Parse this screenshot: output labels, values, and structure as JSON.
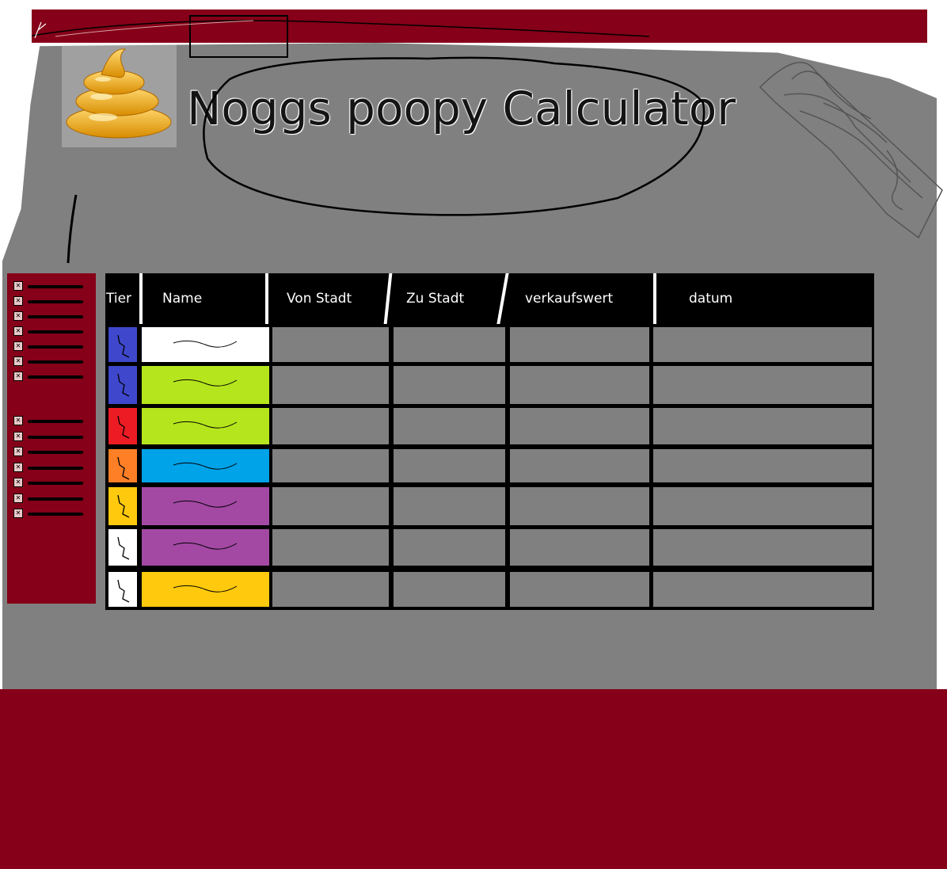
{
  "app": {
    "title": "Noggs poopy Calculator",
    "logo_icon": "poop-icon"
  },
  "colors": {
    "brand": "#850018",
    "background": "#808080",
    "table_border": "#000000"
  },
  "sidebar": {
    "group_1_count": 7,
    "group_2_count": 7,
    "item_icon": "checkbox-icon"
  },
  "table": {
    "columns": [
      {
        "label": "Tier"
      },
      {
        "label": "Name"
      },
      {
        "label": "Von Stadt"
      },
      {
        "label": "Zu Stadt"
      },
      {
        "label": "verkaufswert"
      },
      {
        "label": "datum"
      }
    ],
    "rows": [
      {
        "tier_color": "#3f48cc",
        "name_color": "#ffffff"
      },
      {
        "tier_color": "#3f48cc",
        "name_color": "#b5e61d"
      },
      {
        "tier_color": "#ed1c24",
        "name_color": "#b5e61d"
      },
      {
        "tier_color": "#ff7f27",
        "name_color": "#00a2e8"
      },
      {
        "tier_color": "#ffc90e",
        "name_color": "#a349a4"
      },
      {
        "tier_color": "#ffffff",
        "name_color": "#a349a4"
      },
      {
        "tier_color": "#ffffff",
        "name_color": "#ffc90e"
      }
    ]
  }
}
